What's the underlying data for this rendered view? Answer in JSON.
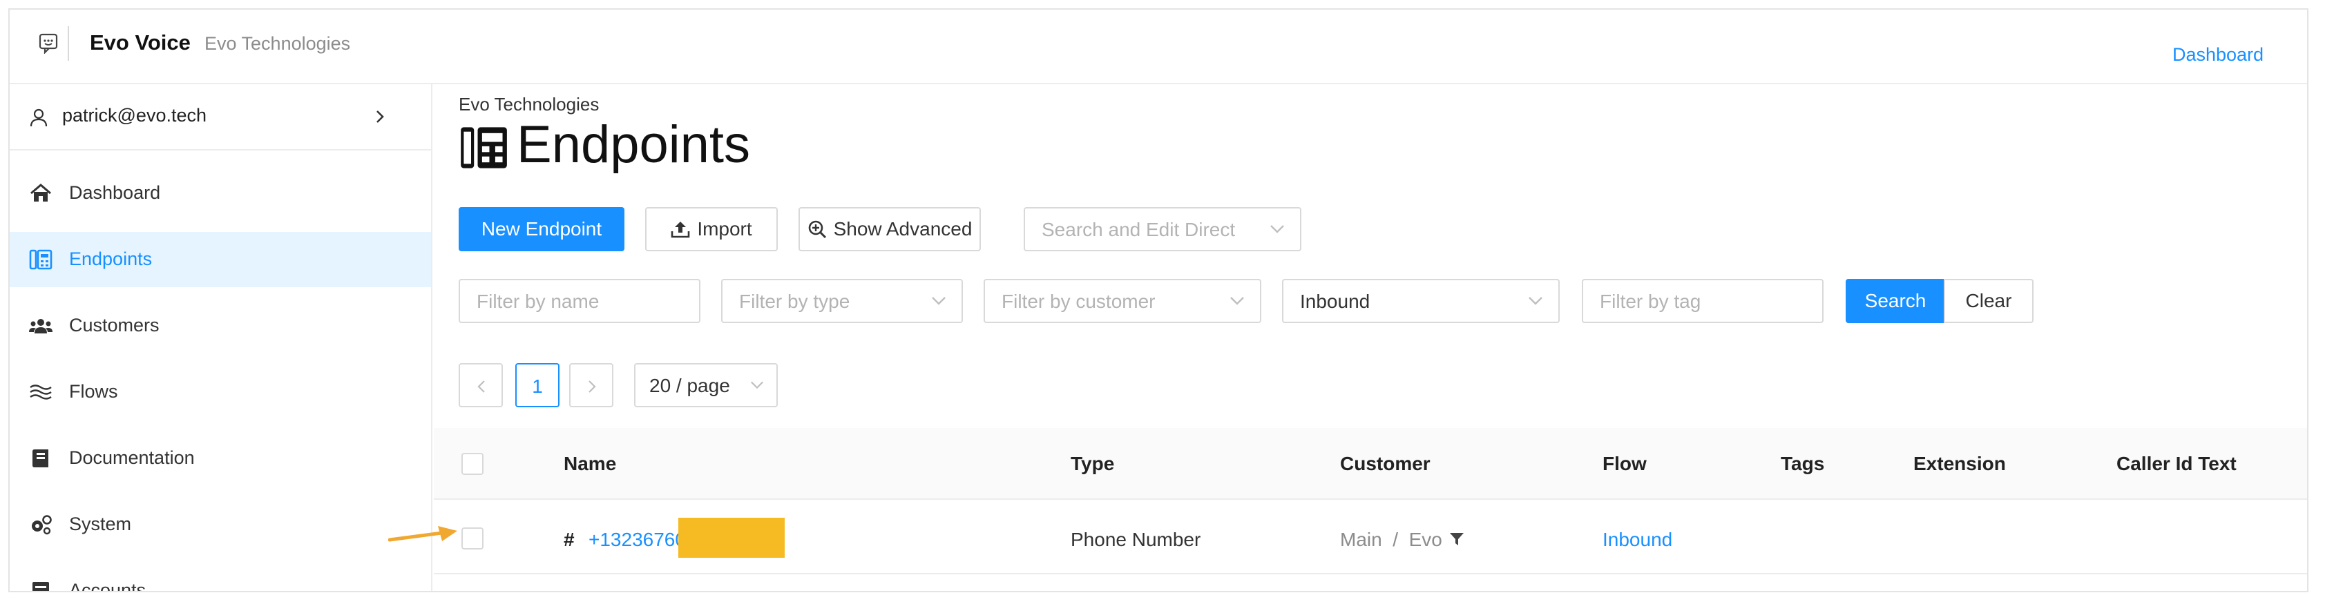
{
  "header": {
    "app_name": "Evo Voice",
    "org_name": "Evo Technologies",
    "tab_label": "Dashboard"
  },
  "sidebar": {
    "user": "patrick@evo.tech",
    "items": [
      {
        "label": "Dashboard",
        "icon": "home-icon"
      },
      {
        "label": "Endpoints",
        "icon": "endpoints-icon"
      },
      {
        "label": "Customers",
        "icon": "users-icon"
      },
      {
        "label": "Flows",
        "icon": "flows-icon"
      },
      {
        "label": "Documentation",
        "icon": "book-icon"
      },
      {
        "label": "System",
        "icon": "gears-icon"
      },
      {
        "label": "Accounts",
        "icon": "accounts-icon"
      }
    ],
    "active_item": "Endpoints"
  },
  "main": {
    "breadcrumb": "Evo Technologies",
    "title": "Endpoints",
    "toolbar": {
      "new_label": "New Endpoint",
      "import_label": "Import",
      "advanced_label": "Show Advanced",
      "search_direct_placeholder": "Search and Edit Direct"
    },
    "filters": {
      "name_placeholder": "Filter by name",
      "type_placeholder": "Filter by type",
      "customer_placeholder": "Filter by customer",
      "direction_value": "Inbound",
      "tag_placeholder": "Filter by tag",
      "search_label": "Search",
      "clear_label": "Clear"
    },
    "pagination": {
      "current_page": "1",
      "page_size": "20 / page"
    },
    "table": {
      "columns": [
        "Name",
        "Type",
        "Customer",
        "Flow",
        "Tags",
        "Extension",
        "Caller Id Text"
      ],
      "rows": [
        {
          "name_prefix": "#",
          "name": "+13236760",
          "type": "Phone Number",
          "customer": "Main  /  Evo",
          "flow": "Inbound",
          "tags": "",
          "extension": "",
          "caller_id_text": ""
        }
      ]
    }
  },
  "colors": {
    "primary": "#1890ff",
    "active_bg": "#e6f4ff",
    "redaction": "#f6bb22",
    "annotation_arrow": "#f0a830"
  }
}
